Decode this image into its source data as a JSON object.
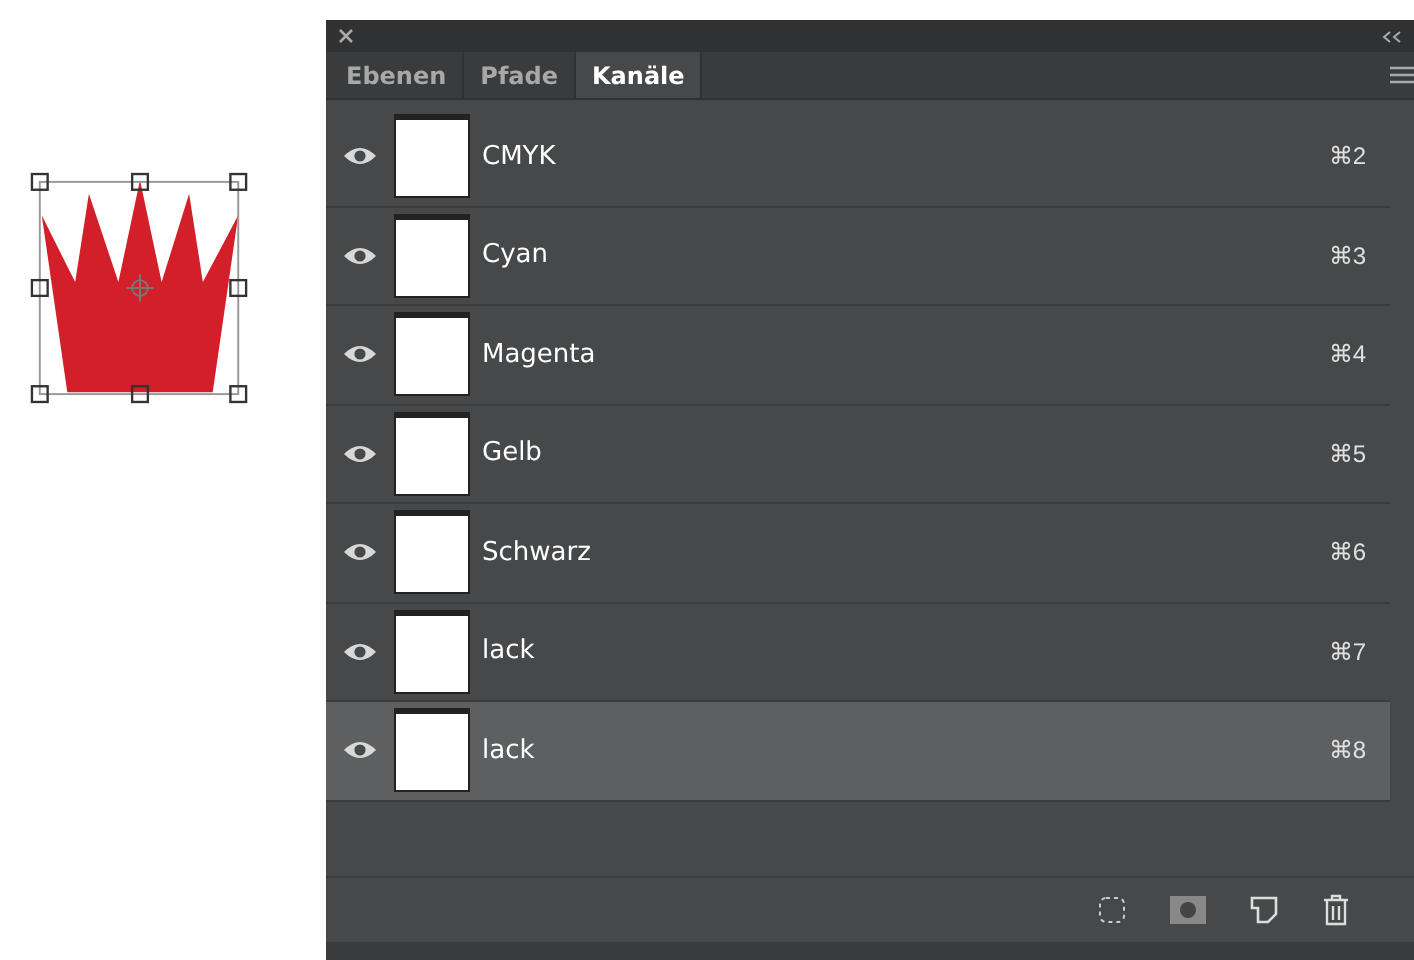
{
  "panel": {
    "tabs": [
      {
        "label": "Ebenen",
        "selected": false
      },
      {
        "label": "Pfade",
        "selected": false
      },
      {
        "label": "Kanäle",
        "selected": true
      }
    ],
    "channels": [
      {
        "name": "CMYK",
        "shortcut": "⌘2",
        "visible": true,
        "selected": false
      },
      {
        "name": "Cyan",
        "shortcut": "⌘3",
        "visible": true,
        "selected": false
      },
      {
        "name": "Magenta",
        "shortcut": "⌘4",
        "visible": true,
        "selected": false
      },
      {
        "name": "Gelb",
        "shortcut": "⌘5",
        "visible": true,
        "selected": false
      },
      {
        "name": "Schwarz",
        "shortcut": "⌘6",
        "visible": true,
        "selected": false
      },
      {
        "name": "lack",
        "shortcut": "⌘7",
        "visible": true,
        "selected": false
      },
      {
        "name": "lack",
        "shortcut": "⌘8",
        "visible": true,
        "selected": true
      }
    ]
  }
}
